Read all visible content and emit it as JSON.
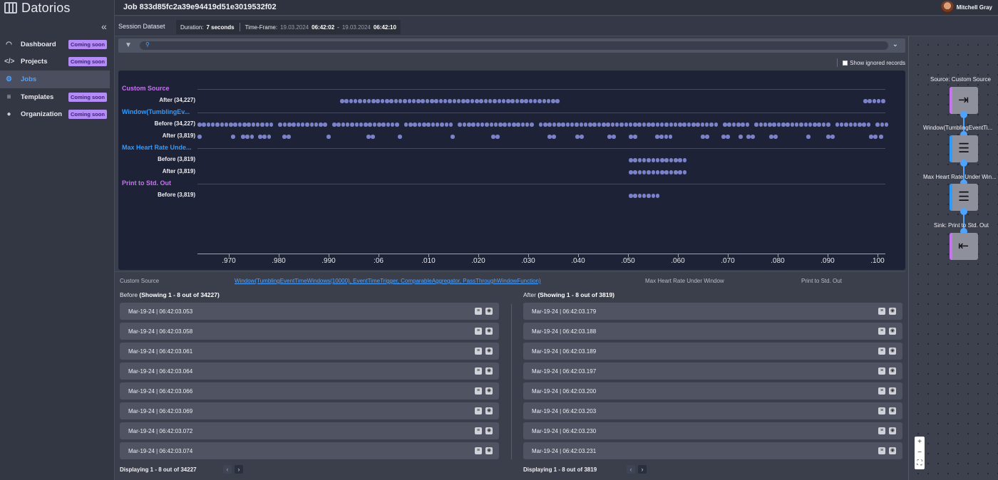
{
  "app": {
    "name": "Datorios"
  },
  "sidebar": {
    "collapse_icon": "double-chevron-left-icon",
    "items": [
      {
        "label": "Dashboard",
        "icon": "speedometer-icon",
        "badge": "Coming soon",
        "active": false
      },
      {
        "label": "Projects",
        "icon": "code-icon",
        "badge": "Coming soon",
        "active": false
      },
      {
        "label": "Jobs",
        "icon": "gear-icon",
        "badge": "",
        "active": true
      },
      {
        "label": "Templates",
        "icon": "database-icon",
        "badge": "Coming soon",
        "active": false
      },
      {
        "label": "Organization",
        "icon": "person-icon",
        "badge": "Coming soon",
        "active": false
      }
    ]
  },
  "header": {
    "job_title": "Job 833d85fc2a39e94419d51e3019532f02",
    "user_name": "Mitchell Gray"
  },
  "session": {
    "label": "Session Dataset",
    "duration_label": "Duration:",
    "duration_value": "7 seconds",
    "timeframe_label": "Time-Frame:",
    "from_date": "19.03.2024",
    "from_time": "06:42:02",
    "dash": "-",
    "to_date": "19.03.2024",
    "to_time": "06:42:10"
  },
  "filter": {
    "search_placeholder": "",
    "show_ignored_label": "Show ignored records",
    "show_ignored_checked": false
  },
  "timeline": {
    "groups": [
      {
        "name": "Custom Source",
        "color": "#c774f0",
        "rows": [
          {
            "label": "After (34,227)"
          }
        ]
      },
      {
        "name": "Window(TumblingEv...",
        "color": "#2d9cff",
        "rows": [
          {
            "label": "Before (34,227)"
          },
          {
            "label": "After (3,819)"
          }
        ]
      },
      {
        "name": "Max Heart Rate Unde...",
        "color": "#2d9cff",
        "rows": [
          {
            "label": "Before (3,819)"
          },
          {
            "label": "After (3,819)"
          }
        ]
      },
      {
        "name": "Print to Std. Out",
        "color": "#c774f0",
        "rows": [
          {
            "label": "Before (3,819)"
          }
        ]
      }
    ],
    "ticks": [
      ".970",
      ".980",
      ".990",
      ":06",
      ".010",
      ".020",
      ".030",
      ".040",
      ".050",
      ".060",
      ".070",
      ".080",
      ".090",
      ".100"
    ]
  },
  "tabs": [
    {
      "label": "Custom Source",
      "active": false
    },
    {
      "label": "Window(TumblingEventTimeWindows(10000), EventTimeTrigger, ComparableAggregator, PassThroughWindowFunction)",
      "active": true
    },
    {
      "label": "Max Heart Rate Under Window",
      "active": false
    },
    {
      "label": "Print to Std. Out",
      "active": false
    }
  ],
  "before_panel": {
    "title": "Before",
    "showing": "(Showing 1 - 8 out of 34227)",
    "records": [
      "Mar-19-24 | 06:42:03.053",
      "Mar-19-24 | 06:42:03.058",
      "Mar-19-24 | 06:42:03.061",
      "Mar-19-24 | 06:42:03.064",
      "Mar-19-24 | 06:42:03.066",
      "Mar-19-24 | 06:42:03.069",
      "Mar-19-24 | 06:42:03.072",
      "Mar-19-24 | 06:42:03.074"
    ],
    "footer": "Displaying 1 - 8 out of 34227"
  },
  "after_panel": {
    "title": "After",
    "showing": "(Showing 1 - 8 out of 3819)",
    "records": [
      "Mar-19-24 | 06:42:03.179",
      "Mar-19-24 | 06:42:03.188",
      "Mar-19-24 | 06:42:03.189",
      "Mar-19-24 | 06:42:03.197",
      "Mar-19-24 | 06:42:03.200",
      "Mar-19-24 | 06:42:03.203",
      "Mar-19-24 | 06:42:03.230",
      "Mar-19-24 | 06:42:03.231"
    ],
    "footer": "Displaying 1 - 8 out of 3819"
  },
  "pipeline": {
    "nodes": [
      {
        "label": "Source: Custom Source",
        "icon": "sign-in-icon",
        "accent": "#c774f0"
      },
      {
        "label": "Window(TumblingEventTi...",
        "icon": "filter-icon",
        "accent": "#2d9cff"
      },
      {
        "label": "Max Heart Rate Under Win...",
        "icon": "filter-icon",
        "accent": "#2d9cff"
      },
      {
        "label": "Sink: Print to Std. Out",
        "icon": "sign-out-icon",
        "accent": "#c774f0"
      }
    ],
    "zoom_controls": [
      "+",
      "−",
      "⛶"
    ]
  },
  "colors": {
    "accent_blue": "#4ea3ff",
    "badge_purple": "#b58cf7",
    "dot": "#7b82c9",
    "timeline_bg": "#1e2236"
  }
}
